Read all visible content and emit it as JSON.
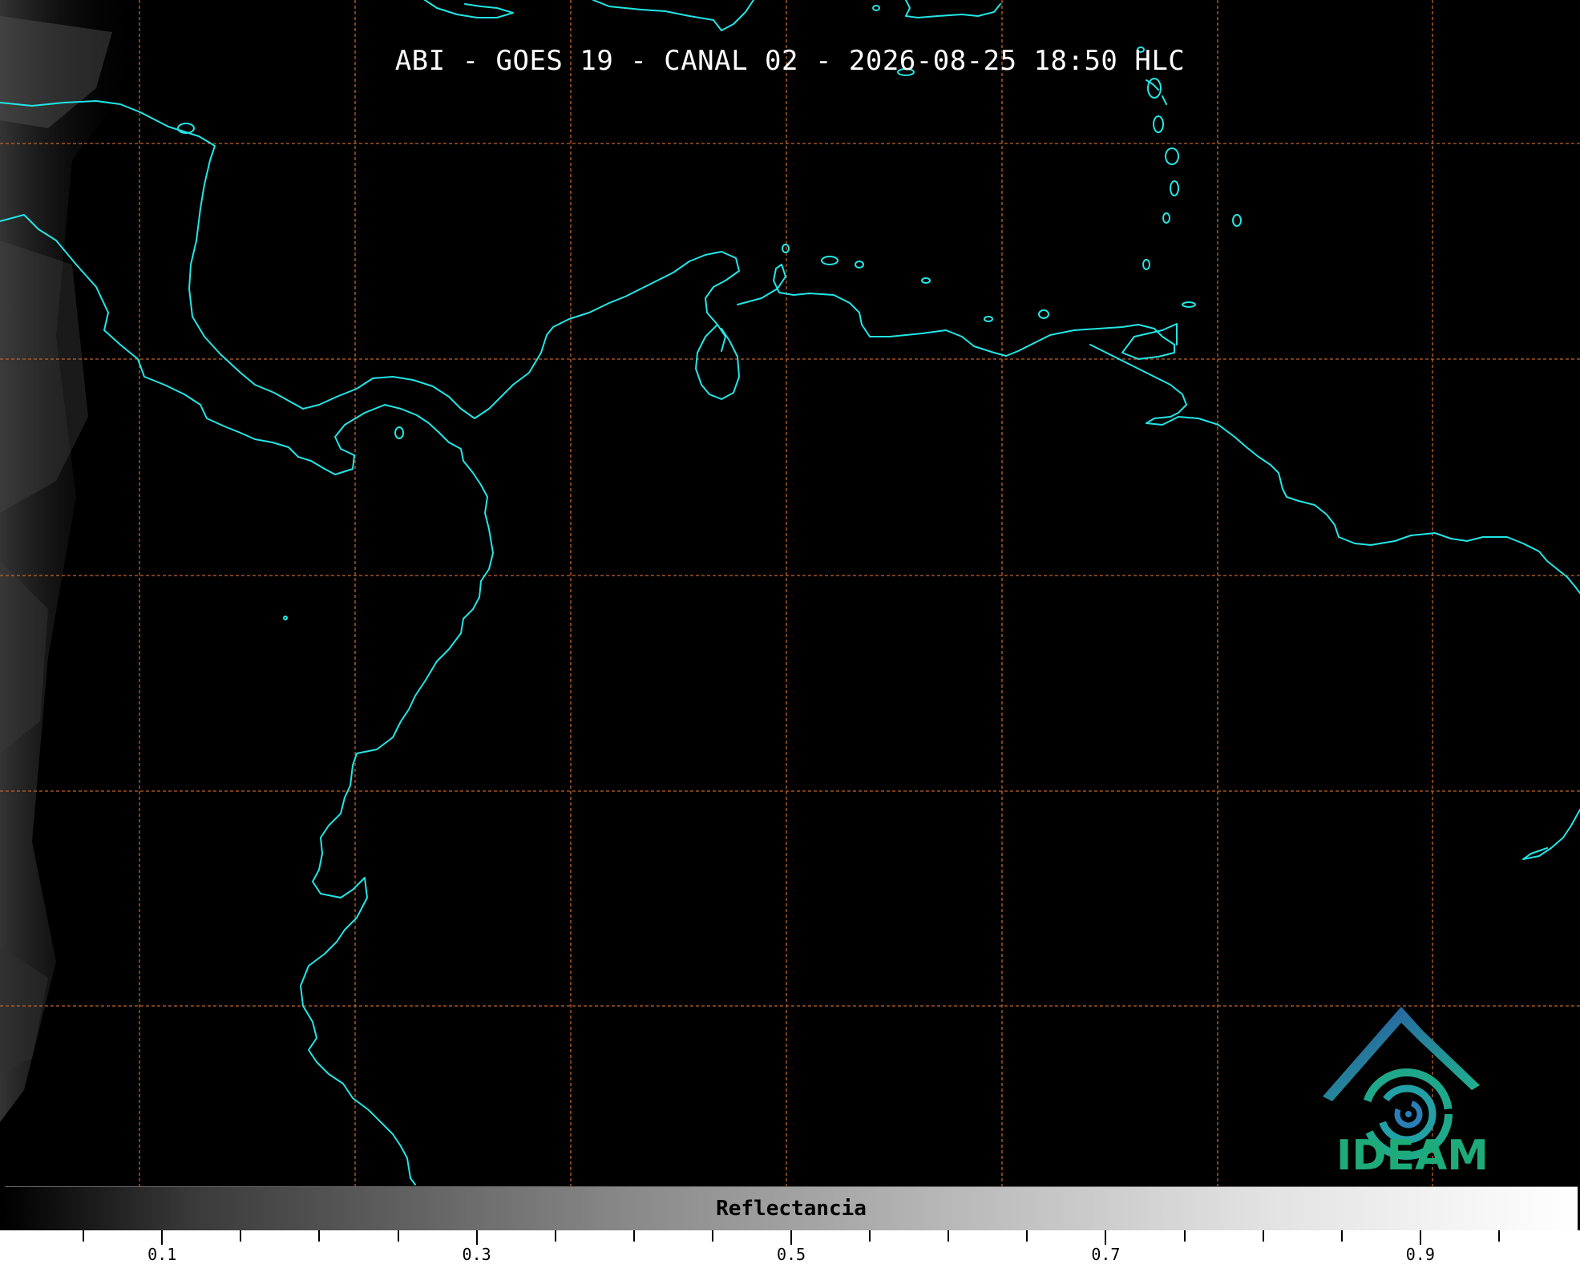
{
  "title": "ABI - GOES 19 - CANAL 02 - 2026-08-25 18:50 HLC",
  "colorbar": {
    "label": "Reflectancia",
    "tick_labels": [
      "0.1",
      "0.3",
      "0.5",
      "0.7",
      "0.9"
    ],
    "range": [
      0.0,
      1.0
    ]
  },
  "logo": {
    "text": "IDEAM"
  },
  "colors": {
    "coastline": "#22e6e6",
    "gridlines": "#c0642a",
    "background": "#000000",
    "logo_green": "#1eab7a",
    "logo_blue": "#2f6fb5"
  },
  "map": {
    "grid": "dashed",
    "coastlines": "shown"
  }
}
